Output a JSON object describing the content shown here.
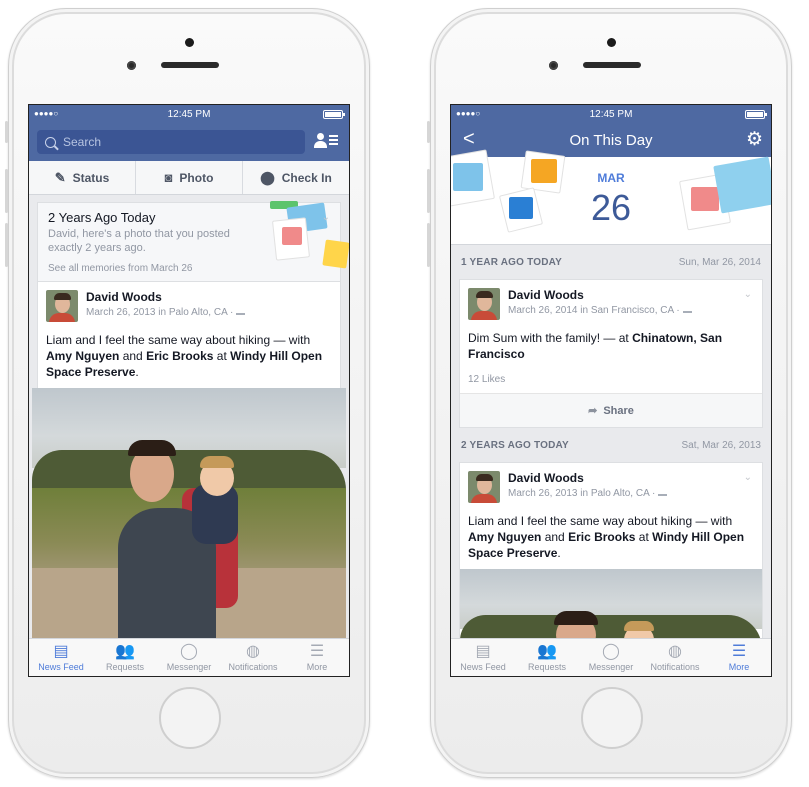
{
  "left_phone": {
    "status": {
      "time": "12:45 PM",
      "signal": "●●●●○"
    },
    "search": {
      "placeholder": "Search"
    },
    "actions": [
      {
        "label": "Status",
        "icon": "pencil-square-icon"
      },
      {
        "label": "Photo",
        "icon": "camera-icon"
      },
      {
        "label": "Check In",
        "icon": "location-pin-icon"
      }
    ],
    "memory": {
      "title": "2 Years Ago Today",
      "subtitle": "David, here's a photo that you posted exactly 2 years ago.",
      "link": "See all memories from March 26"
    },
    "post": {
      "author": "David Woods",
      "meta": "March 26, 2013 in Palo Alto, CA ·",
      "text_1": "Liam and I feel the same way about hiking — with",
      "tag_1": "Amy Nguyen",
      "and": "and",
      "tag_2": "Eric Brooks",
      "at": "at",
      "place": "Windy Hill Open Space Preserve",
      "end": "."
    },
    "tabs": [
      {
        "label": "News Feed",
        "icon": "newsfeed-icon",
        "active": true
      },
      {
        "label": "Requests",
        "icon": "friend-requests-icon",
        "active": false
      },
      {
        "label": "Messenger",
        "icon": "messenger-icon",
        "active": false
      },
      {
        "label": "Notifications",
        "icon": "globe-icon",
        "active": false
      },
      {
        "label": "More",
        "icon": "menu-icon",
        "active": false
      }
    ]
  },
  "right_phone": {
    "status": {
      "time": "12:45 PM",
      "signal": "●●●●○"
    },
    "nav": {
      "title": "On This Day",
      "back": "<",
      "gear": "⚙"
    },
    "hero": {
      "month": "MAR",
      "day": "26"
    },
    "section_1": {
      "label": "1 YEAR AGO TODAY",
      "date": "Sun, Mar 26, 2014"
    },
    "post_1": {
      "author": "David Woods",
      "meta": "March 26, 2014 in San Francisco, CA ·",
      "text": "Dim Sum with the family! — at",
      "place": "Chinatown, San Francisco",
      "likes": "12 Likes",
      "share": "Share"
    },
    "section_2": {
      "label": "2 YEARS AGO TODAY",
      "date": "Sat, Mar 26, 2013"
    },
    "post_2": {
      "author": "David Woods",
      "meta": "March 26, 2013 in Palo Alto, CA ·",
      "text_1": "Liam and I feel the same way about hiking — with",
      "tag_1": "Amy Nguyen",
      "and": "and",
      "tag_2": "Eric Brooks",
      "at": "at",
      "place": "Windy Hill Open Space Preserve",
      "end": "."
    },
    "tabs": [
      {
        "label": "News Feed",
        "icon": "newsfeed-icon",
        "active": false
      },
      {
        "label": "Requests",
        "icon": "friend-requests-icon",
        "active": false
      },
      {
        "label": "Messenger",
        "icon": "messenger-icon",
        "active": false
      },
      {
        "label": "Notifications",
        "icon": "globe-icon",
        "active": false
      },
      {
        "label": "More",
        "icon": "menu-icon",
        "active": true
      }
    ]
  },
  "colors": {
    "brand_blue": "#4e69a2",
    "active_tab": "#4f7cd9",
    "date_blue": "#3d5a98"
  }
}
